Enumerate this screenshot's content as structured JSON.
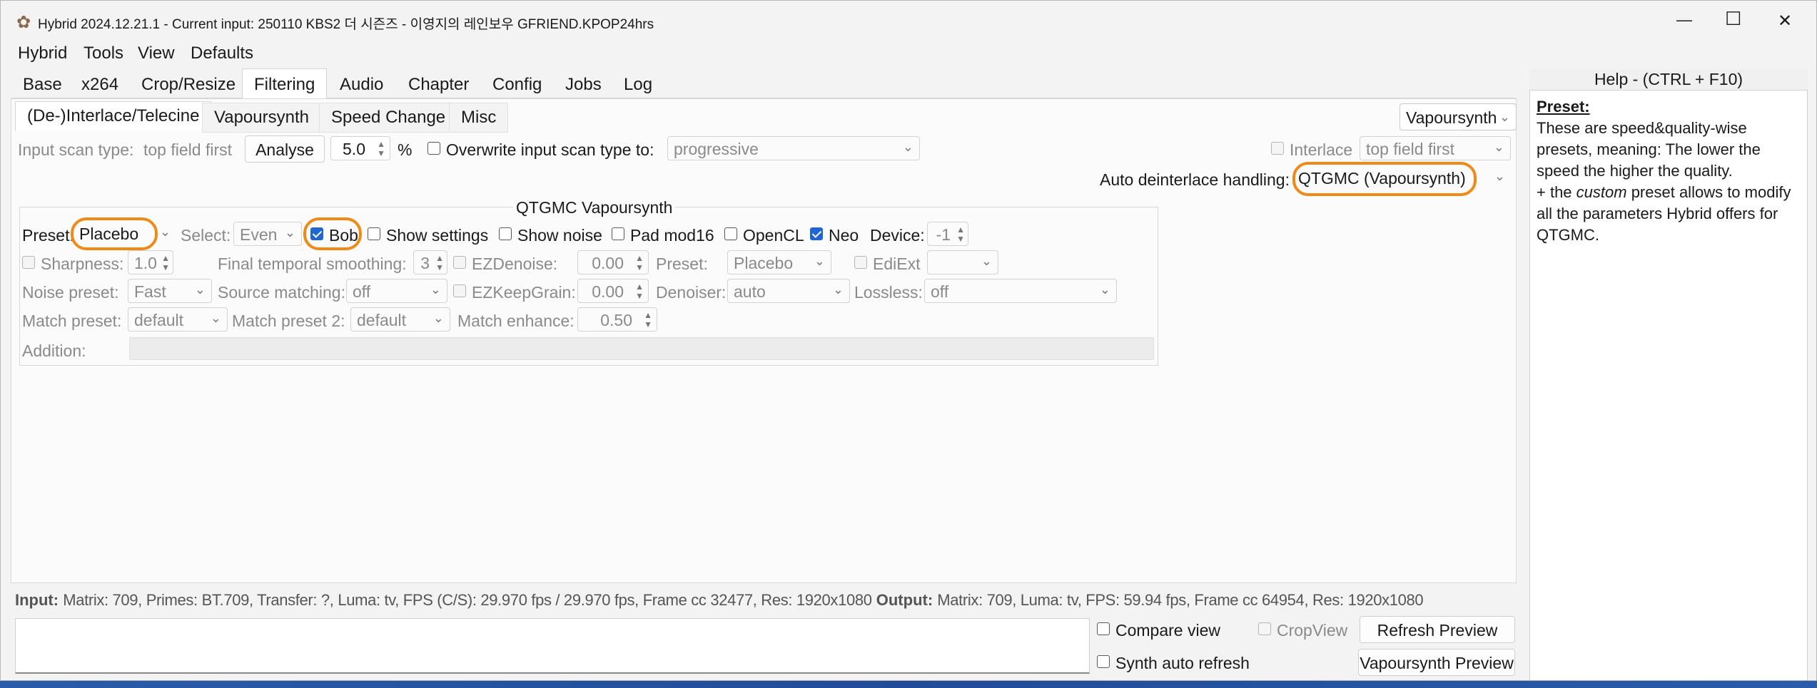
{
  "window": {
    "title": "Hybrid 2024.12.21.1 - Current input: 250110 KBS2 더 시즌즈 - 이영지의 레인보우 GFRIEND.KPOP24hrs",
    "controls": {
      "minimize": "—",
      "maximize": "☐",
      "close": "✕"
    }
  },
  "menu": [
    "Hybrid",
    "Tools",
    "View",
    "Defaults"
  ],
  "main_tabs": [
    "Base",
    "x264",
    "Crop/Resize",
    "Filtering",
    "Audio",
    "Chapter",
    "Config",
    "Jobs",
    "Log"
  ],
  "active_main_tab": "Filtering",
  "sub_tabs": [
    "(De-)Interlace/Telecine",
    "Vapoursynth",
    "Speed Change",
    "Misc"
  ],
  "active_sub_tab": "(De-)Interlace/Telecine",
  "engine_select": "Vapoursynth",
  "scan": {
    "label": "Input scan type:",
    "value": "top field first",
    "analyse_button": "Analyse",
    "percent_value": "5.0",
    "percent_unit": "%",
    "overwrite_label": "Overwrite input scan type to:",
    "overwrite_value": "progressive",
    "interlace_label": "Interlace",
    "interlace_value": "top field first"
  },
  "auto_deinterlace": {
    "label": "Auto deinterlace handling:",
    "value": "QTGMC (Vapoursynth)"
  },
  "qtgmc": {
    "group_title": "QTGMC Vapoursynth",
    "preset_label": "Preset:",
    "preset_value": "Placebo",
    "select_label": "Select:",
    "select_value": "Even",
    "bob_label": "Bob",
    "bob_checked": true,
    "show_settings_label": "Show settings",
    "show_noise_label": "Show noise",
    "pad_mod16_label": "Pad mod16",
    "opencl_label": "OpenCL",
    "neo_label": "Neo",
    "neo_checked": true,
    "device_label": "Device:",
    "device_value": "-1",
    "sharpness_label": "Sharpness:",
    "sharpness_value": "1.0",
    "final_temporal_label": "Final temporal smoothing:",
    "final_temporal_value": "3",
    "ezdenoise_label": "EZDenoise:",
    "ezdenoise_value": "0.00",
    "preset2_label": "Preset:",
    "preset2_value": "Placebo",
    "ediext_label": "EdiExt",
    "ediext_value": "",
    "noise_preset_label": "Noise preset:",
    "noise_preset_value": "Fast",
    "source_matching_label": "Source matching:",
    "source_matching_value": "off",
    "ezkeepgrain_label": "EZKeepGrain:",
    "ezkeepgrain_value": "0.00",
    "denoiser_label": "Denoiser:",
    "denoiser_value": "auto",
    "lossless_label": "Lossless:",
    "lossless_value": "off",
    "match_preset_label": "Match preset:",
    "match_preset_value": "default",
    "match_preset2_label": "Match preset 2:",
    "match_preset2_value": "default",
    "match_enhance_label": "Match enhance:",
    "match_enhance_value": "0.50",
    "addition_label": "Addition:",
    "addition_value": ""
  },
  "status": {
    "input_label": "Input:",
    "input_text": "Matrix: 709, Primes: BT.709, Transfer: ?, Luma: tv, FPS (C/S): 29.970 fps / 29.970 fps, Frame cc 32477, Res: 1920x1080",
    "output_label": "Output:",
    "output_text": "Matrix: 709, Luma: tv, FPS: 59.94 fps, Frame cc 64954, Res: 1920x1080"
  },
  "preview": {
    "compare_view": "Compare view",
    "cropview": "CropView",
    "refresh_preview": "Refresh Preview",
    "synth_auto_refresh": "Synth auto refresh",
    "vapoursynth_preview": "Vapoursynth Preview"
  },
  "help": {
    "header": "Help - (CTRL + F10)",
    "title": "Preset:",
    "text1": "These are speed&quality-wise presets, meaning: The lower the speed the higher the quality.",
    "text2_prefix": "+ the ",
    "text2_em": "custom",
    "text2_suffix": " preset allows to modify all the parameters Hybrid offers for QTGMC."
  },
  "colors": {
    "highlight": "#f08a16",
    "checkbox_on": "#1e66d4"
  }
}
